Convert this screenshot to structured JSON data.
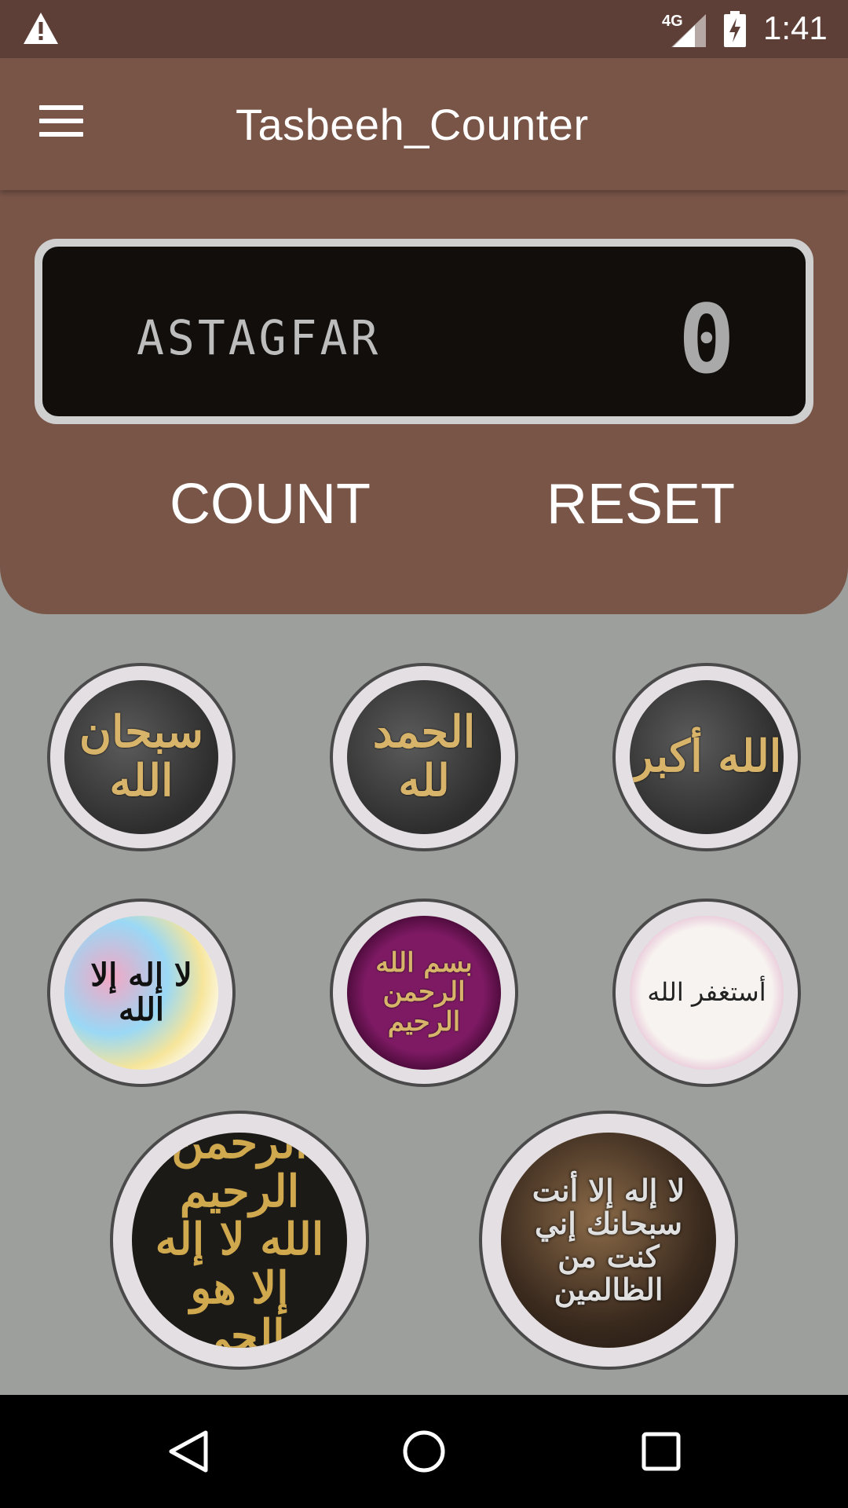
{
  "status_bar": {
    "network": "4G",
    "time": "1:41",
    "icons": [
      "warning-icon",
      "signal-icon",
      "battery-charging-icon"
    ]
  },
  "app_bar": {
    "title": "Tasbeeh_Counter",
    "menu_icon": "hamburger-menu-icon"
  },
  "counter": {
    "dhikr_name": "ASTAGFAR",
    "count": "0",
    "count_label": "COUNT",
    "reset_label": "RESET"
  },
  "dhikr_buttons": [
    {
      "name": "subhanallah",
      "text": "سبحان الله"
    },
    {
      "name": "alhamdulillah",
      "text": "الحمد لله"
    },
    {
      "name": "allahu-akbar",
      "text": "الله أكبر"
    },
    {
      "name": "la-ilaha-illallah",
      "text": "لا إله إلا الله"
    },
    {
      "name": "bismillah",
      "text": "بسم الله الرحمن الرحيم"
    },
    {
      "name": "astaghfirullah",
      "text": "أستغفر الله"
    },
    {
      "name": "ayat-ul-kursi",
      "text": "بسم الله الرحمن الرحيم الله لا إله إلا هو الحي القيوم"
    },
    {
      "name": "la-ilaha-illa-anta",
      "text": "لا إله إلا أنت سبحانك إني كنت من الظالمين"
    }
  ],
  "nav_bar": {
    "icons": [
      "back-icon",
      "home-icon",
      "recents-icon"
    ]
  },
  "colors": {
    "status_bar": "#5d3f38",
    "primary": "#795548",
    "background": "#9d9f9c",
    "display": "#110e0b"
  }
}
